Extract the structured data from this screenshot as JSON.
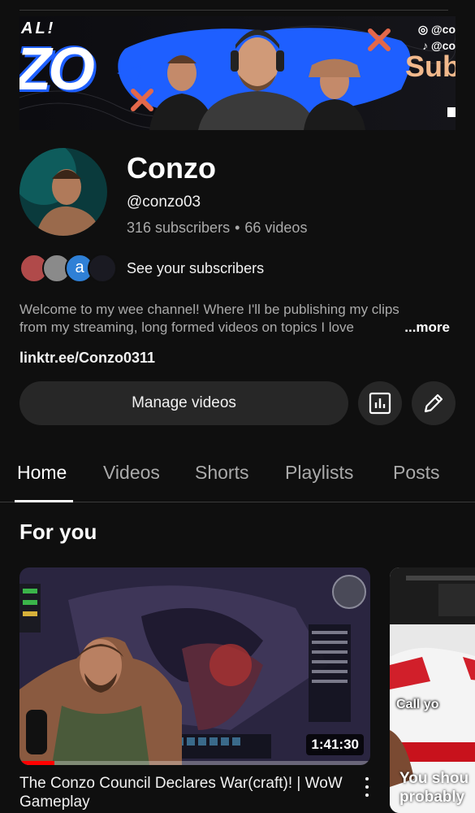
{
  "banner": {
    "logo_top": "AL!",
    "logo_main": "ZO",
    "handle_1": "@co",
    "handle_2": "@co",
    "sub_text": "Sub"
  },
  "channel": {
    "name": "Conzo",
    "handle": "@conzo03",
    "subscribers": "316 subscribers",
    "separator": "•",
    "videos": "66 videos",
    "see_subscribers": "See your subscribers",
    "subscriber_avatar_letter": "a",
    "description_line1": "Welcome to my wee channel! Where I'll be publishing my clips",
    "description_line2": "from my streaming, long formed videos on topics I love",
    "more_label": "...more",
    "link": "linktr.ee/Conzo0311"
  },
  "actions": {
    "manage_videos": "Manage videos",
    "analytics_icon": "bar-chart-icon",
    "edit_icon": "pencil-icon"
  },
  "tabs": [
    {
      "label": "Home",
      "active": true
    },
    {
      "label": "Videos",
      "active": false
    },
    {
      "label": "Shorts",
      "active": false
    },
    {
      "label": "Playlists",
      "active": false
    },
    {
      "label": "Posts",
      "active": false
    }
  ],
  "section": {
    "title": "For you"
  },
  "videos": [
    {
      "title": "The Conzo Council Declares War(craft)! | WoW Gameplay",
      "duration": "1:41:30",
      "watched_fraction": 0.1
    },
    {
      "caption": "Call yo",
      "title_line1": "You shou",
      "title_line2": "probably"
    }
  ],
  "colors": {
    "background": "#0f0f0f",
    "button": "#272727",
    "secondary_text": "#aaaaaa",
    "progress": "#ff0000",
    "banner_accent": "#1e5fff"
  }
}
